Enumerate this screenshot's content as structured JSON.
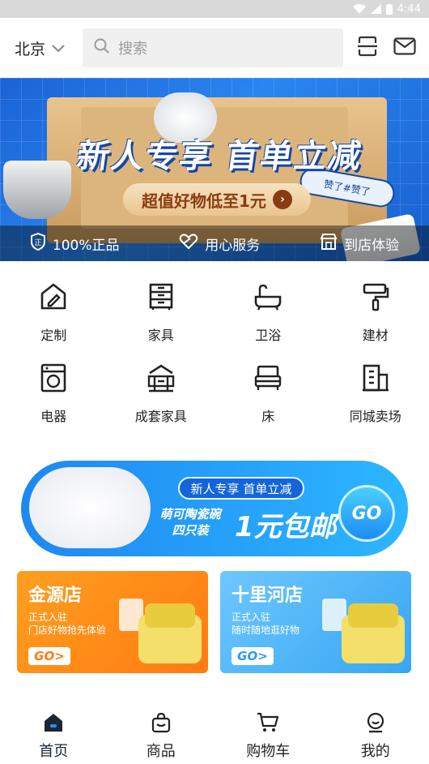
{
  "status_bar": {
    "time": "4:44"
  },
  "header": {
    "city": "北京",
    "search_placeholder": "搜索",
    "icons": [
      "chevron-down-icon",
      "search-icon",
      "scan-icon",
      "mail-icon"
    ]
  },
  "banner": {
    "title": "新人专享 首单立减",
    "subtitle": "超值好物低至1元",
    "badge": "赞了#赞了",
    "trust": [
      {
        "icon": "shield-icon",
        "label": "100%正品"
      },
      {
        "icon": "heart-hand-icon",
        "label": "用心服务"
      },
      {
        "icon": "store-icon",
        "label": "到店体验"
      }
    ]
  },
  "categories": [
    {
      "icon": "custom-house-icon",
      "label": "定制"
    },
    {
      "icon": "cabinet-icon",
      "label": "家具"
    },
    {
      "icon": "bathtub-icon",
      "label": "卫浴"
    },
    {
      "icon": "paint-roller-icon",
      "label": "建材"
    },
    {
      "icon": "washing-machine-icon",
      "label": "电器"
    },
    {
      "icon": "furniture-set-icon",
      "label": "成套家具"
    },
    {
      "icon": "bed-icon",
      "label": "床"
    },
    {
      "icon": "building-icon",
      "label": "同城卖场"
    }
  ],
  "promo": {
    "tag": "新人专享 首单立减",
    "line1": "萌可陶瓷碗",
    "line2": "四只装",
    "headline": "1元包邮",
    "go": "GO"
  },
  "stores": [
    {
      "name": "金源店",
      "line1": "正式入驻",
      "line2": "门店好物抢先体验",
      "go": "GO>"
    },
    {
      "name": "十里河店",
      "line1": "正式入驻",
      "line2": "随时随地逛好物",
      "go": "GO>"
    }
  ],
  "tabs": [
    {
      "icon": "home-icon",
      "label": "首页",
      "active": true
    },
    {
      "icon": "shopping-bag-icon",
      "label": "商品"
    },
    {
      "icon": "cart-icon",
      "label": "购物车"
    },
    {
      "icon": "user-icon",
      "label": "我的"
    }
  ]
}
